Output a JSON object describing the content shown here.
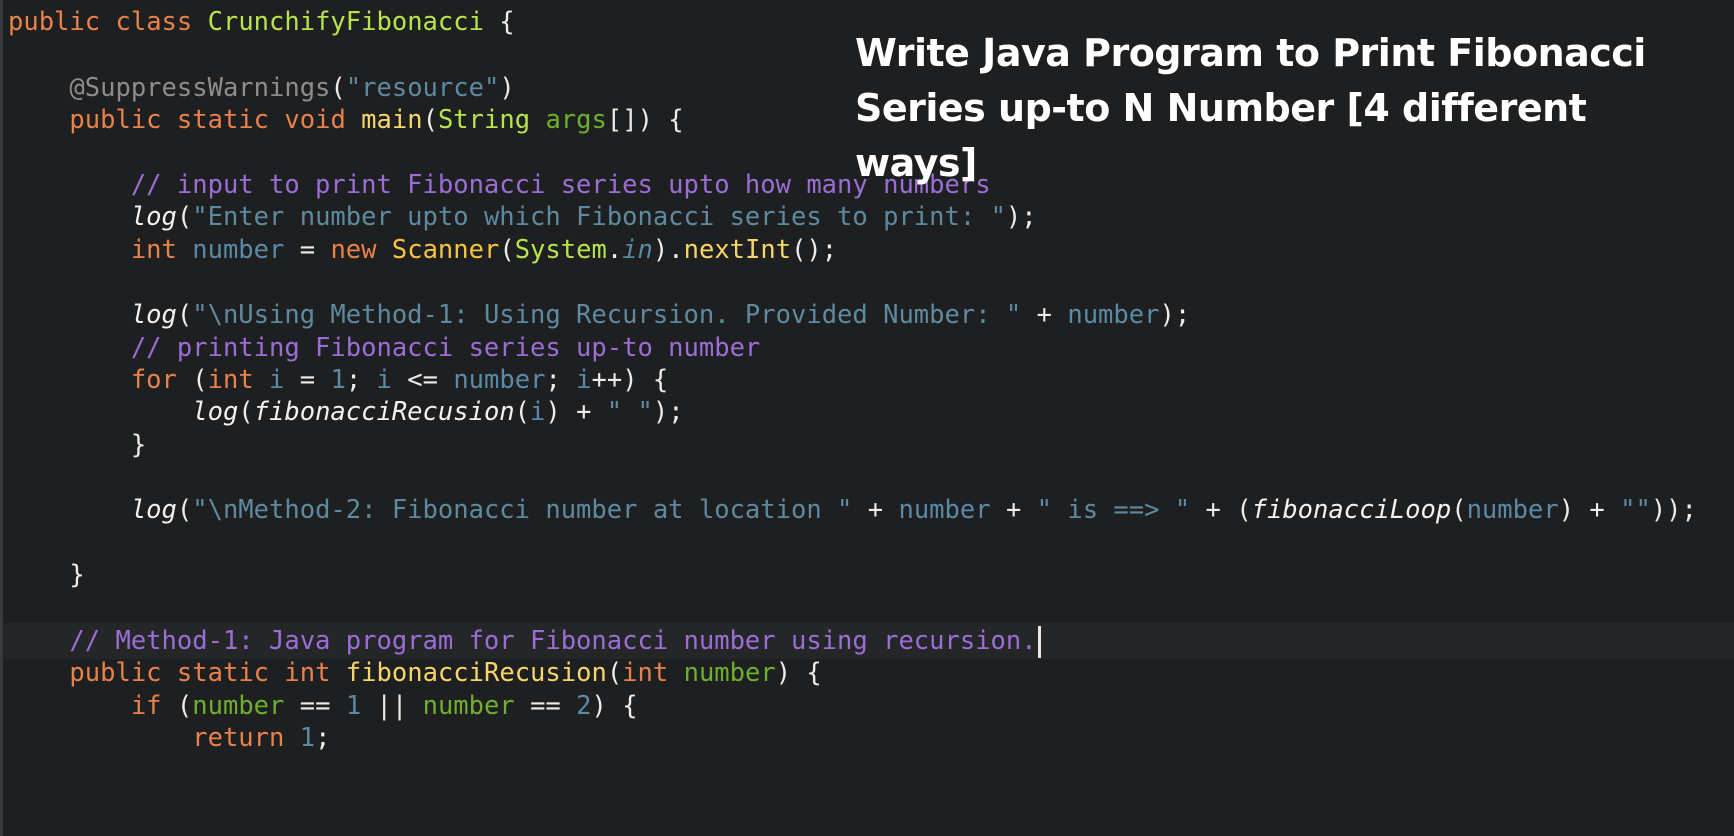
{
  "title_overlay": {
    "line1": "Write Java Program to Print Fibonacci",
    "line2": "Series up-to N Number [4 different ways]"
  },
  "code": {
    "class_decl": {
      "public": "public",
      "class": "class",
      "name": "CrunchifyFibonacci",
      "brace": " {"
    },
    "annotation": {
      "name": "@SuppressWarnings",
      "open": "(",
      "value": "\"resource\"",
      "close": ")"
    },
    "main_decl": {
      "public": "public",
      "static": "static",
      "void": "void",
      "name": "main",
      "open": "(",
      "type": "String",
      "param": "args",
      "rest": "[]) {"
    },
    "comment_input": "// input to print Fibonacci series upto how many numbers",
    "log_enter": {
      "fn": "log",
      "open": "(",
      "str": "\"Enter number upto which Fibonacci series to print: \"",
      "close": ");"
    },
    "scanner_line": {
      "int": "int",
      "var": "number",
      "eq": " = ",
      "new": "new",
      "cls": "Scanner",
      "open": "(",
      "system": "System",
      "dot": ".",
      "in": "in",
      "rest1": ").",
      "method": "nextInt",
      "rest2": "();"
    },
    "log_method1": {
      "fn": "log",
      "open": "(",
      "str": "\"\\nUsing Method-1: Using Recursion. Provided Number: \"",
      "plus": " + ",
      "var": "number",
      "close": ");"
    },
    "comment_printing": "// printing Fibonacci series up-to number",
    "for_line": {
      "for": "for",
      "open": " (",
      "int": "int",
      "i1": "i",
      "eq": " = ",
      "one": "1",
      "semi1": "; ",
      "i2": "i",
      "le": " <= ",
      "var": "number",
      "semi2": "; ",
      "i3": "i",
      "rest": "++) {"
    },
    "log_fib": {
      "fn": "log",
      "open": "(",
      "call": "fibonacciRecusion",
      "open2": "(",
      "i": "i",
      "close2": ")",
      "plus": " + ",
      "str": "\" \"",
      "close": ");"
    },
    "close_for": "}",
    "log_method2": {
      "fn": "log",
      "open": "(",
      "str1": "\"\\nMethod-2: Fibonacci number at location \"",
      "plus1": " + ",
      "var1": "number",
      "plus2": " + ",
      "str2": "\" is ==> \"",
      "plus3": " + (",
      "call": "fibonacciLoop",
      "open2": "(",
      "var2": "number",
      "close2": ")",
      "plus4": " + ",
      "str3": "\"\"",
      "close": "));"
    },
    "close_main": "}",
    "comment_method1": "// Method-1: Java program for Fibonacci number using recursion.",
    "recursion_decl": {
      "public": "public",
      "static": "static",
      "int": "int",
      "name": "fibonacciRecusion",
      "open": "(",
      "type": "int",
      "param": "number",
      "rest": ") {"
    },
    "if_line": {
      "if": "if",
      "open": " (",
      "var1": "number",
      "eq1": " == ",
      "one": "1",
      "or": " || ",
      "var2": "number",
      "eq2": " == ",
      "two": "2",
      "rest": ") {"
    },
    "return_line": {
      "return": "return",
      "space": " ",
      "one": "1",
      "semi": ";"
    }
  }
}
